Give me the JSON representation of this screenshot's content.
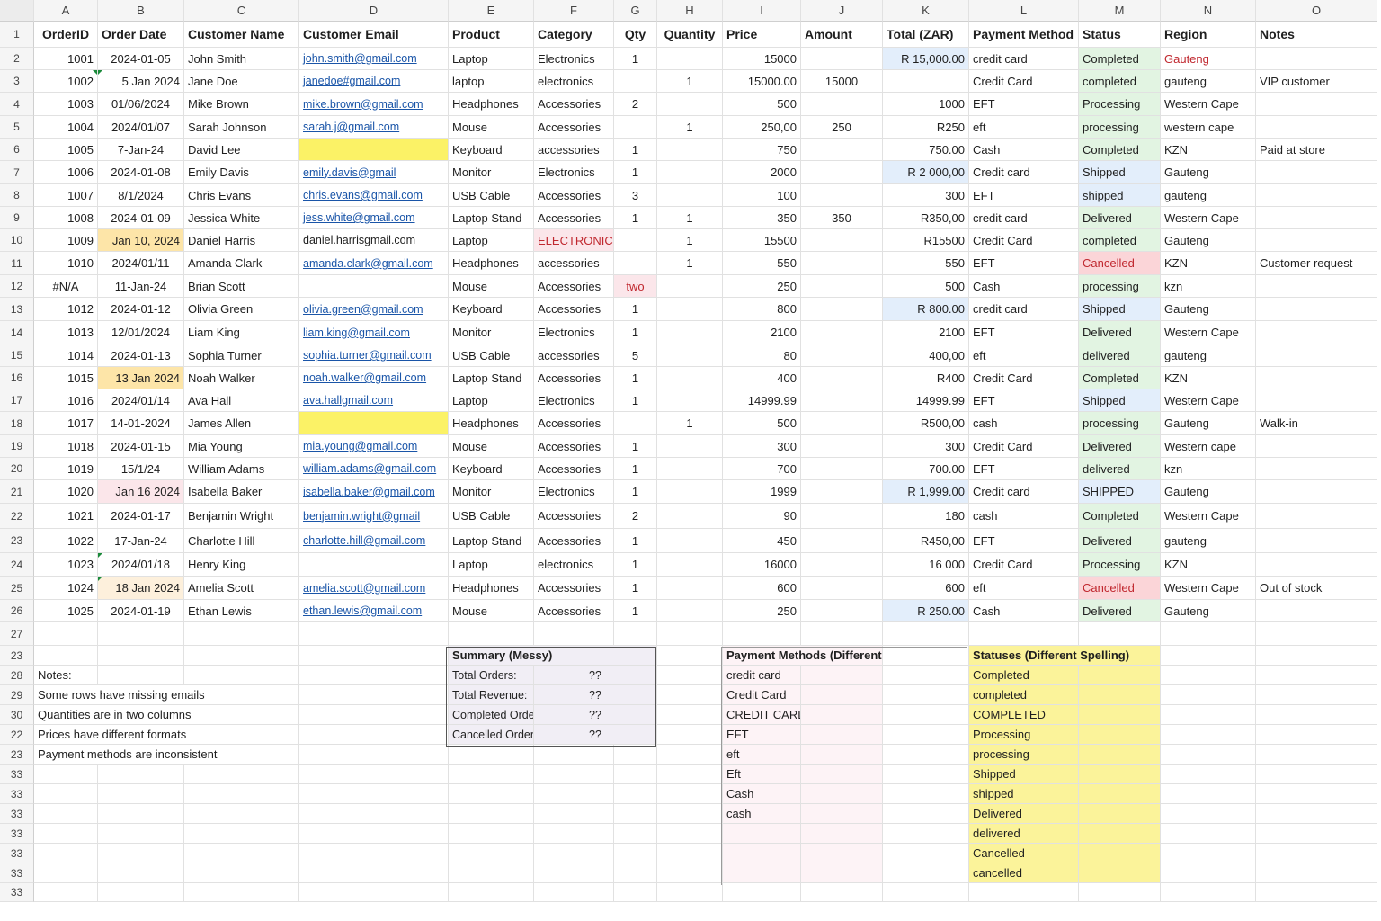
{
  "columns": [
    "A",
    "B",
    "C",
    "D",
    "E",
    "F",
    "G",
    "H",
    "I",
    "J",
    "K",
    "L",
    "M",
    "N",
    "O"
  ],
  "row_numbers": [
    "1",
    "2",
    "3",
    "4",
    "5",
    "6",
    "7",
    "8",
    "9",
    "10",
    "11",
    "12",
    "13",
    "14",
    "15",
    "16",
    "17",
    "18",
    "19",
    "20",
    "21",
    "22",
    "23",
    "24",
    "25",
    "26",
    "27",
    "23",
    "28",
    "29",
    "30",
    "22",
    "23",
    "33",
    "33",
    "33",
    "33",
    "33",
    "33",
    "33",
    "32"
  ],
  "headers": [
    "OrderID",
    "Order Date",
    "Customer Name",
    "Customer Email",
    "Product",
    "Category",
    "Qty",
    "Quantity",
    "Price",
    "Amount",
    "Total (ZAR)",
    "Payment Method",
    "Status",
    "Region",
    "Notes"
  ],
  "rows": [
    [
      "1001",
      "2024-01-05",
      "John Smith",
      "john.smith@gmail.com",
      "Laptop",
      "Electronics",
      "1",
      "",
      "15000",
      "",
      "R 15,000.00",
      "credit card",
      "Completed",
      "Gauteng",
      ""
    ],
    [
      "1002",
      "5 Jan 2024",
      "Jane Doe",
      "janedoe#gmail.com",
      "laptop",
      "electronics",
      "",
      "1",
      "15000.00",
      "15000",
      "",
      "Credit Card",
      "completed",
      "gauteng",
      "VIP customer"
    ],
    [
      "1003",
      "01/06/2024",
      "Mike Brown",
      "mike.brown@gmail.com",
      "Headphones",
      "Accessories",
      "2",
      "",
      "500",
      "",
      "1000",
      "EFT",
      "Processing",
      "Western Cape",
      ""
    ],
    [
      "1004",
      "2024/01/07",
      "Sarah Johnson",
      "sarah.j@gmail.com",
      "Mouse",
      "Accessories",
      "",
      "1",
      "250,00",
      "250",
      "R250",
      "eft",
      "processing",
      "western cape",
      ""
    ],
    [
      "1005",
      "7-Jan-24",
      "David Lee",
      "",
      "Keyboard",
      "accessories",
      "1",
      "",
      "750",
      "",
      "750.00",
      "Cash",
      "Completed",
      "KZN",
      "Paid at store"
    ],
    [
      "1006",
      "2024-01-08",
      "Emily Davis",
      "emily.davis@gmail",
      "Monitor",
      "Electronics",
      "1",
      "",
      "2000",
      "",
      "R 2 000,00",
      "Credit card",
      "Shipped",
      "Gauteng",
      ""
    ],
    [
      "1007",
      "8/1/2024",
      "Chris Evans",
      "chris.evans@gmail.com",
      "USB Cable",
      "Accessories",
      "3",
      "",
      "100",
      "",
      "300",
      "EFT",
      "shipped",
      "gauteng",
      ""
    ],
    [
      "1008",
      "2024-01-09",
      "Jessica White",
      "jess.white@gmail.com",
      "Laptop Stand",
      "Accessories",
      "1",
      "1",
      "350",
      "350",
      "R350,00",
      "credit card",
      "Delivered",
      "Western Cape",
      ""
    ],
    [
      "1009",
      "Jan 10, 2024",
      "Daniel Harris",
      "daniel.harrisgmail.com",
      "Laptop",
      "ELECTRONICS",
      "",
      "1",
      "15500",
      "",
      "R15500",
      "Credit Card",
      "completed",
      "Gauteng",
      ""
    ],
    [
      "1010",
      "2024/01/11",
      "Amanda Clark",
      "amanda.clark@gmail.com",
      "Headphones",
      "accessories",
      "",
      "1",
      "550",
      "",
      "550",
      "EFT",
      "Cancelled",
      "KZN",
      "Customer request"
    ],
    [
      "#N/A",
      "11-Jan-24",
      "Brian Scott",
      "",
      "Mouse",
      "Accessories",
      "two",
      "",
      "250",
      "",
      "500",
      "Cash",
      "processing",
      "kzn",
      ""
    ],
    [
      "1012",
      "2024-01-12",
      "Olivia Green",
      "olivia.green@gmail.com",
      "Keyboard",
      "Accessories",
      "1",
      "",
      "800",
      "",
      "R 800.00",
      "credit card",
      "Shipped",
      "Gauteng",
      ""
    ],
    [
      "1013",
      "12/01/2024",
      "Liam King",
      "liam.king@gmail.com",
      "Monitor",
      "Electronics",
      "1",
      "",
      "2100",
      "",
      "2100",
      "EFT",
      "Delivered",
      "Western Cape",
      ""
    ],
    [
      "1014",
      "2024-01-13",
      "Sophia Turner",
      "sophia.turner@gmail.com",
      "USB Cable",
      "accessories",
      "5",
      "",
      "80",
      "",
      "400,00",
      "eft",
      "delivered",
      "gauteng",
      ""
    ],
    [
      "1015",
      "13 Jan 2024",
      "Noah Walker",
      "noah.walker@gmail.com",
      "Laptop Stand",
      "Accessories",
      "1",
      "",
      "400",
      "",
      "R400",
      "Credit Card",
      "Completed",
      "KZN",
      ""
    ],
    [
      "1016",
      "2024/01/14",
      "Ava Hall",
      "ava.hallgmail.com",
      "Laptop",
      "Electronics",
      "1",
      "",
      "14999.99",
      "",
      "14999.99",
      "EFT",
      "Shipped",
      "Western Cape",
      ""
    ],
    [
      "1017",
      "14-01-2024",
      "James Allen",
      "",
      "Headphones",
      "Accessories",
      "",
      "1",
      "500",
      "",
      "R500,00",
      "cash",
      "processing",
      "Gauteng",
      "Walk-in"
    ],
    [
      "1018",
      "2024-01-15",
      "Mia Young",
      "mia.young@gmail.com",
      "Mouse",
      "Accessories",
      "1",
      "",
      "300",
      "",
      "300",
      "Credit Card",
      "Delivered",
      "Western cape",
      ""
    ],
    [
      "1019",
      "15/1/24",
      "William Adams",
      "william.adams@gmail.com",
      "Keyboard",
      "Accessories",
      "1",
      "",
      "700",
      "",
      "700.00",
      "EFT",
      "delivered",
      "kzn",
      ""
    ],
    [
      "1020",
      "Jan 16 2024",
      "Isabella Baker",
      "isabella.baker@gmail.com",
      "Monitor",
      "Electronics",
      "1",
      "",
      "1999",
      "",
      "R 1,999.00",
      "Credit card",
      "SHIPPED",
      "Gauteng",
      ""
    ],
    [
      "1021",
      "2024-01-17",
      "Benjamin Wright",
      "benjamin.wright@gmail",
      "USB Cable",
      "Accessories",
      "2",
      "",
      "90",
      "",
      "180",
      "cash",
      "Completed",
      "Western Cape",
      ""
    ],
    [
      "1022",
      "17-Jan-24",
      "Charlotte Hill",
      "charlotte.hill@gmail.com",
      "Laptop Stand",
      "Accessories",
      "1",
      "",
      "450",
      "",
      "R450,00",
      "EFT",
      "Delivered",
      "gauteng",
      ""
    ],
    [
      "1023",
      "2024/01/18",
      "Henry King",
      "",
      "Laptop",
      "electronics",
      "1",
      "",
      "16000",
      "",
      "16 000",
      "Credit Card",
      "Processing",
      "KZN",
      ""
    ],
    [
      "1024",
      "18 Jan 2024",
      "Amelia Scott",
      "amelia.scott@gmail.com",
      "Headphones",
      "Accessories",
      "1",
      "",
      "600",
      "",
      "600",
      "eft",
      "Cancelled",
      "Western Cape",
      "Out of stock"
    ],
    [
      "1025",
      "2024-01-19",
      "Ethan Lewis",
      "ethan.lewis@gmail.com",
      "Mouse",
      "Accessories",
      "1",
      "",
      "250",
      "",
      "R 250.00",
      "Cash",
      "Delivered",
      "Gauteng",
      ""
    ]
  ],
  "notes": {
    "title": "Notes:",
    "items": [
      "Some rows have missing emails",
      "Quantities are in two columns",
      "Prices have different formats",
      "Payment methods are inconsistent"
    ]
  },
  "summary": {
    "title": "Summary (Messy)",
    "rows": [
      {
        "label": "Total Orders:",
        "value": "??"
      },
      {
        "label": "Total Revenue:",
        "value": "??"
      },
      {
        "label": "Completed Orders:",
        "value": "??"
      },
      {
        "label": "Cancelled Orders:",
        "value": "??"
      }
    ]
  },
  "payment_methods": {
    "title": "Payment Methods (Different Spelling)",
    "items": [
      "credit card",
      "Credit Card",
      "CREDIT CARD",
      "EFT",
      "eft",
      "Eft",
      "Cash",
      "cash"
    ]
  },
  "statuses": {
    "title": "Statuses (Different Spelling)",
    "items": [
      "Completed",
      "completed",
      "COMPLETED",
      "Processing",
      "processing",
      "Shipped",
      "shipped",
      "Delivered",
      "delivered",
      "Cancelled",
      "cancelled"
    ]
  },
  "colors": {
    "missing_email_fill": "#fbf266",
    "status_completed_fill": "#e2f4e2",
    "status_cancelled_fill": "#fbd5d8",
    "status_shipped_fill": "#e3eefb",
    "link_color": "#1a55a8",
    "status_list_fill": "#fbf39a"
  }
}
